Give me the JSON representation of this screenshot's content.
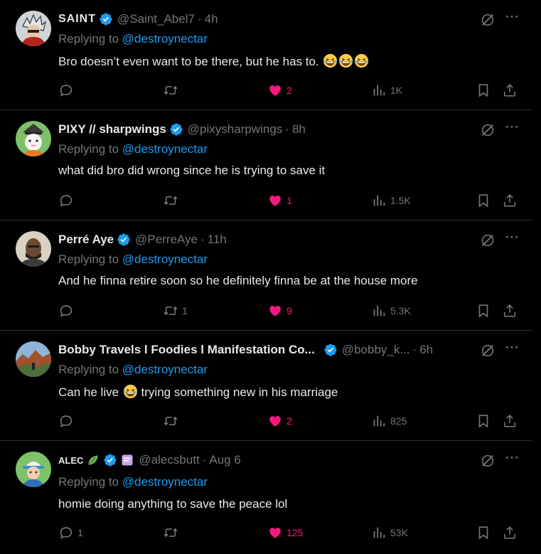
{
  "colors": {
    "background": "#000000",
    "text": "#e7e9ea",
    "muted": "#71767b",
    "link": "#1d9bf0",
    "like": "#f91880",
    "divider": "#2f3336"
  },
  "posts": [
    {
      "name": "SAINT",
      "handle": "@Saint_Abel7",
      "time": "4h",
      "reply_prefix": "Replying to",
      "reply_to": "@destroynectar",
      "text": "Bro doesn’t even want to be there, but he has to.",
      "replies": "",
      "reposts": "",
      "likes": "2",
      "views": "1K"
    },
    {
      "name": "PIXY // sharpwings",
      "handle": "@pixysharpwings",
      "time": "8h",
      "reply_prefix": "Replying to",
      "reply_to": "@destroynectar",
      "text": "what did bro did wrong since he is trying to save it",
      "replies": "",
      "reposts": "",
      "likes": "1",
      "views": "1.5K"
    },
    {
      "name": "Perré Aye",
      "handle": "@PerreAye",
      "time": "11h",
      "reply_prefix": "Replying to",
      "reply_to": "@destroynectar",
      "text": "And he finna retire soon so he definitely finna be at the house more",
      "replies": "",
      "reposts": "1",
      "likes": "9",
      "views": "5.3K"
    },
    {
      "name": "Bobby Travels l Foodies l Manifestation Co...",
      "handle": "@bobby_k...",
      "time": "6h",
      "reply_prefix": "Replying to",
      "reply_to": "@destroynectar",
      "text_before": "Can he live",
      "text_after": "trying something new in his marriage",
      "replies": "",
      "reposts": "",
      "likes": "2",
      "views": "825"
    },
    {
      "name": "ALEC",
      "handle": "@alecsbutt",
      "time": "Aug 6",
      "reply_prefix": "Replying to",
      "reply_to": "@destroynectar",
      "text": "homie doing anything to save the peace lol",
      "replies": "1",
      "reposts": "",
      "likes": "125",
      "views": "53K"
    }
  ],
  "icons": [
    "verified-badge-icon",
    "grok-icon",
    "more-icon",
    "reply-icon",
    "repost-icon",
    "heart-icon",
    "views-icon",
    "bookmark-icon",
    "share-icon",
    "laughing-emoji",
    "leaf-emoji",
    "id-badge-icon"
  ]
}
